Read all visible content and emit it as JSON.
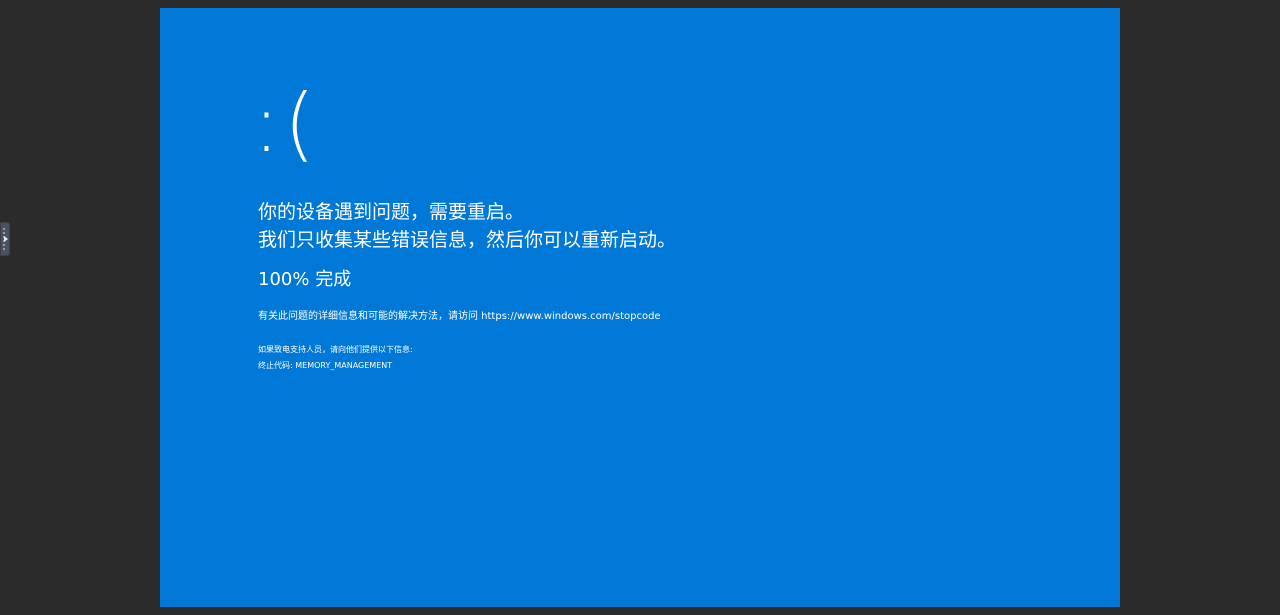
{
  "screen": {
    "background_color": "#0078d7",
    "viewer_background_color": "#2b2b2b",
    "frown": ":(",
    "message_line1": "你的设备遇到问题，需要重启。",
    "message_line2": "我们只收集某些错误信息，然后你可以重新启动。",
    "progress_percent": "100%",
    "progress_label": "完成",
    "info_text": "有关此问题的详细信息和可能的解决方法，请访问 https://www.windows.com/stopcode",
    "support_text": "如果致电支持人员，请向他们提供以下信息:",
    "stop_code_label": "终止代码:",
    "stop_code": "MEMORY_MANAGEMENT"
  },
  "sidebar_handle": {
    "icon": "panel-expand-arrow-icon"
  }
}
